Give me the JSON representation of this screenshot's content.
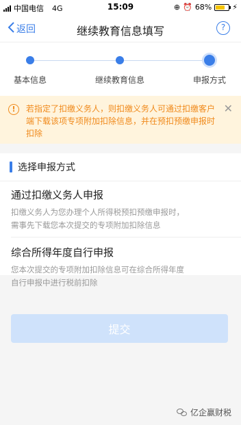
{
  "status_bar": {
    "carrier": "中国电信",
    "network": "4G",
    "time": "15:09",
    "battery": "68%",
    "battery_level": 0.68
  },
  "nav": {
    "back_label": "返回",
    "title": "继续教育信息填写",
    "help_label": "?"
  },
  "steps": [
    {
      "label": "基本信息"
    },
    {
      "label": "继续教育信息"
    },
    {
      "label": "申报方式"
    }
  ],
  "notice": {
    "text": "若指定了扣缴义务人，则扣缴义务人可通过扣缴客户端下载该项专项附加扣除信息，并在预扣预缴申报时扣除",
    "icon_glyph": "!",
    "close_glyph": "✕"
  },
  "section": {
    "title": "选择申报方式",
    "options": [
      {
        "title": "通过扣缴义务人申报",
        "desc_line1": "扣缴义务人为您办理个人所得税预扣预缴申报时，",
        "desc_line2": "需事先下载您本次提交的专项附加扣除信息"
      },
      {
        "title": "综合所得年度自行申报",
        "desc_line1": "您本次提交的专项附加扣除信息可在综合所得年度",
        "desc_line2": "自行申报中进行税前扣除"
      }
    ]
  },
  "submit_label": "提交",
  "watermark": "亿企赢财税",
  "colors": {
    "accent": "#3a7ee8",
    "warning": "#f08a1c",
    "warning_bg": "#fff4dd",
    "submit_disabled": "#cfe2fb"
  }
}
